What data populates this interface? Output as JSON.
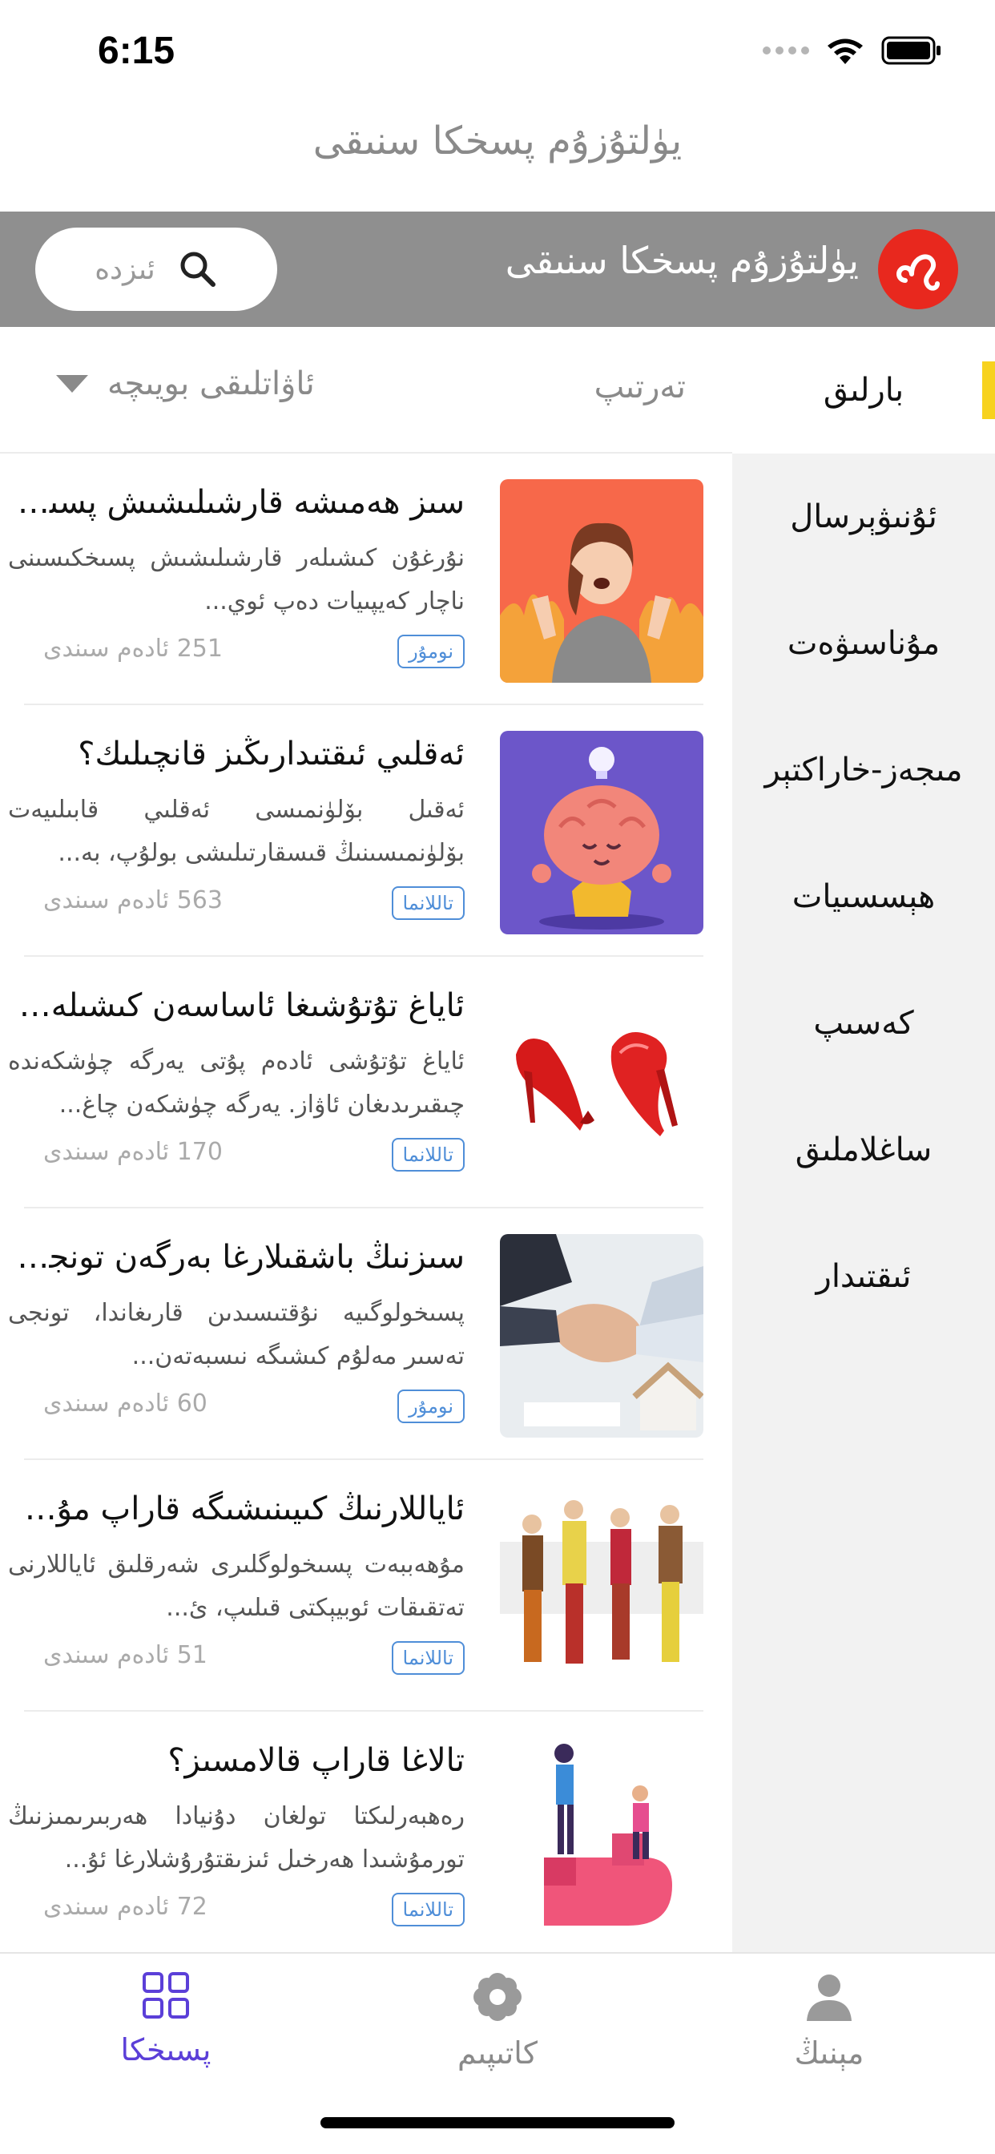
{
  "status_bar": {
    "time": "6:15"
  },
  "app": {
    "title": "يۈلتۇزۇم پسخكا سنىقى"
  },
  "header": {
    "name": "يۈلتۇزۇم پسخكا سنىقى",
    "search_placeholder": "ئىزدە"
  },
  "sort_bar": {
    "sort_label": "تەرتىپ",
    "age_filter_label": "ئاۋاتلىقى بويىچە"
  },
  "sidebar": {
    "items": [
      {
        "label": "بارلىق",
        "active": true
      },
      {
        "label": "ئۇنىۋېرسال"
      },
      {
        "label": "مۇناسىۋەت"
      },
      {
        "label": "مىجەز-خاراكتېر"
      },
      {
        "label": "ھېسسىيات"
      },
      {
        "label": "كەسىپ"
      },
      {
        "label": "ساغلاملىق"
      },
      {
        "label": "ئىقتىدار"
      }
    ]
  },
  "articles": [
    {
      "title": "سىز ھەمىشە قارشىلىشىش پسىخ...",
      "desc": "نۇرغۇن كىشىلەر قارشىلىشىش پسىخكىسىنى ناچار كەيپىيات دەپ ئوي...",
      "badge": "نومۇر",
      "views": "251 ئادەم سىندى"
    },
    {
      "title": "ئەقلىي ئىقتىدارىڭىز قانچىلىك؟",
      "desc": "ئەقىل بۆلۈنمىسى ئەقلىي قابىلىيەت بۆلۈنمىسىنىڭ قىسقارتىلىشى بولۇپ، بە...",
      "badge": "تاللانما",
      "views": "563 ئادەم سىندى"
    },
    {
      "title": "ئاياغ تۇتۇشىغا ئاساسەن كىشىلەرنى...",
      "desc": "ئاياغ تۇتۇشى ئادەم پۇتى يەرگە چۈشكەندە چىقىرىدىغان ئاۋاز. يەرگە چۈشكەن چاغ...",
      "badge": "تاللانما",
      "views": "170 ئادەم سىندى"
    },
    {
      "title": "سىزنىڭ باشقىلارغا بەرگەن تونجى...",
      "desc": "پسىخولوگىيە نۇقتىسىدىن قارىغاندا، تونجى تەسىر مەلۇم كىشىگە نىسبەتەن...",
      "badge": "نومۇر",
      "views": "60 ئادەم سىندى"
    },
    {
      "title": "ئاياللارنىڭ كىيىنىشىگە قاراپ مۇھ...",
      "desc": "مۇھەببەت پسىخولوگلىرى شەرقلىق ئاياللارنى تەتقىقات ئوبيېكتى قىلىپ، ئ...",
      "badge": "تاللانما",
      "views": "51 ئادەم سىندى"
    },
    {
      "title": "تالاغا قاراپ قالامسىز؟",
      "desc": "رەھبەرلىكتا تولغان دۇنيادا ھەربىرىمىزنىڭ تورمۇشىدا ھەرخىل ئىزىقتۇرۇشلارغا ئۇ...",
      "badge": "تاللانما",
      "views": "72 ئادەم سىندى"
    }
  ],
  "tabs": [
    {
      "label": "پسىخكا",
      "active": true
    },
    {
      "label": "كاتىپىم"
    },
    {
      "label": "مېنىڭ"
    }
  ],
  "colors": {
    "accent": "#5b3fd8",
    "header_bg": "#8f8f8f",
    "indicator": "#f7d21e",
    "badge": "#4f8ed8",
    "logo": "#e8281e"
  }
}
